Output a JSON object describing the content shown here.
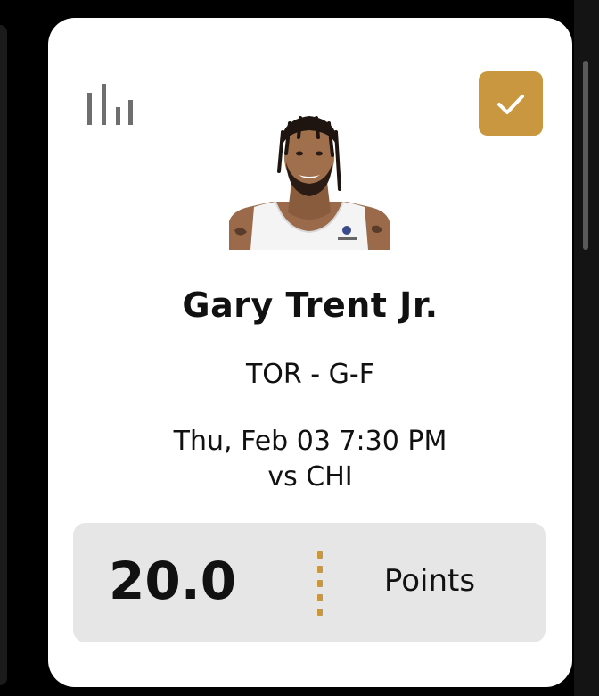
{
  "colors": {
    "accent": "#c9973f",
    "card_bg": "#ffffff",
    "page_bg": "#000000",
    "projection_bg": "#e6e6e6",
    "stats_icon": "#6e6e6e",
    "text": "#111111"
  },
  "icons": {
    "stats": "bar-chart-icon",
    "selected": "checkmark-icon"
  },
  "player": {
    "name": "Gary Trent Jr.",
    "team_position": "TOR - G-F",
    "photo_alt": "Gary Trent Jr. headshot"
  },
  "game": {
    "datetime": "Thu, Feb 03 7:30 PM",
    "opponent": "vs CHI"
  },
  "projection": {
    "value": "20.0",
    "stat": "Points"
  },
  "selected": true
}
